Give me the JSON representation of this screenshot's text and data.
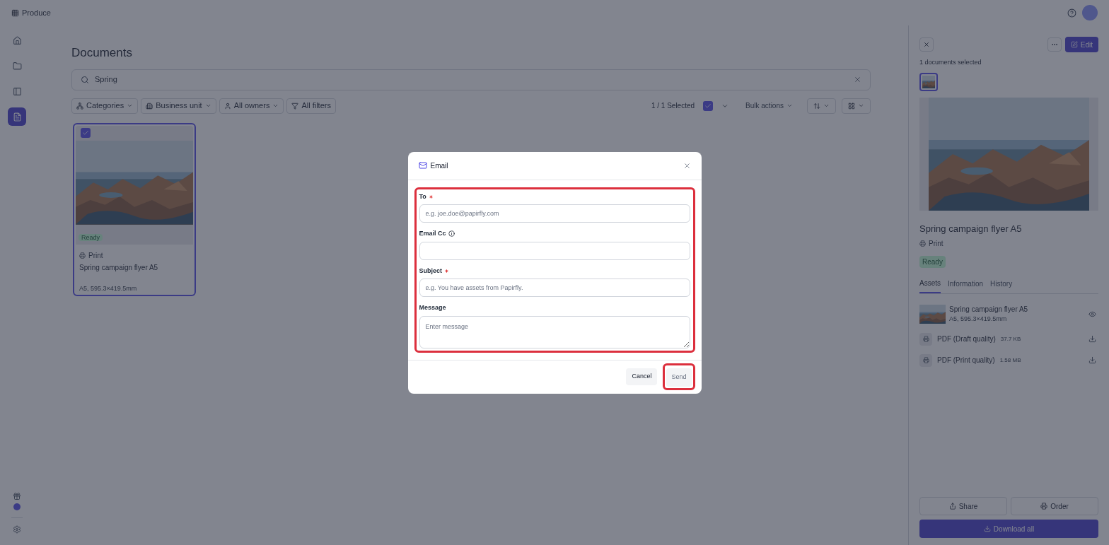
{
  "app": {
    "name": "Produce"
  },
  "sidebar": {
    "items": [
      {
        "kind": "home",
        "selected": false
      },
      {
        "kind": "folder",
        "selected": false
      },
      {
        "kind": "layout",
        "selected": false
      },
      {
        "kind": "document",
        "selected": true
      }
    ]
  },
  "page": {
    "title": "Documents",
    "search": {
      "value": "Spring"
    },
    "filters": [
      {
        "kind": "categories",
        "label": "Categories"
      },
      {
        "kind": "business",
        "label": "Business unit"
      },
      {
        "kind": "owners",
        "label": "All owners"
      },
      {
        "kind": "all",
        "label": "All filters"
      }
    ],
    "selection": {
      "count": "1 / 1 Selected",
      "checked": true,
      "bulk": "Bulk actions"
    },
    "cards": [
      {
        "selected": true,
        "status": "Ready",
        "type": "Print",
        "title": "Spring campaign flyer A5",
        "meta": "A5, 595.3×419.5mm"
      }
    ]
  },
  "panel": {
    "edit": "Edit",
    "selected_count": "1 documents selected",
    "title": "Spring campaign flyer A5",
    "type": "Print",
    "status": "Ready",
    "tabs": [
      {
        "label": "Assets",
        "selected": true
      },
      {
        "label": "Information",
        "selected": false
      },
      {
        "label": "History",
        "selected": false
      }
    ],
    "assets": [
      {
        "kind": "preview",
        "name": "Spring campaign flyer A5",
        "meta": "A5, 595.3×419.5mm"
      },
      {
        "kind": "file",
        "name": "PDF (Draft quality)",
        "meta": "37.7 KB"
      },
      {
        "kind": "file",
        "name": "PDF (Print quality)",
        "meta": "1.58 MB"
      }
    ],
    "share": "Share",
    "order": "Order",
    "download": "Download all"
  },
  "dialog": {
    "title": "Email",
    "fields": [
      {
        "label": "To",
        "required": true,
        "info": false,
        "kind": "input",
        "placeholder": "e.g. joe.doe@papirfly.com"
      },
      {
        "label": "Email Cc",
        "required": false,
        "info": true,
        "kind": "input"
      },
      {
        "label": "Subject",
        "required": true,
        "info": false,
        "kind": "input",
        "placeholder": "e.g. You have assets from Papirfly."
      },
      {
        "label": "Message",
        "required": false,
        "info": false,
        "kind": "textarea",
        "placeholder": "Enter message"
      }
    ],
    "cancel": "Cancel",
    "send": {
      "label": "Send",
      "disabled": true
    }
  }
}
